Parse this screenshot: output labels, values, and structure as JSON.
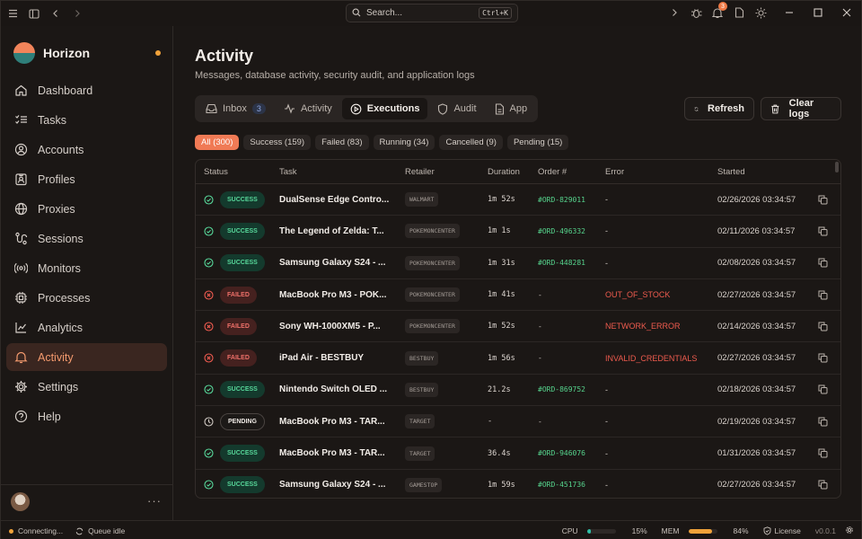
{
  "search": {
    "placeholder": "Search...",
    "shortcut": "Ctrl+K"
  },
  "topbar": {
    "notification_count": "3"
  },
  "brand": {
    "name": "Horizon"
  },
  "sidebar": {
    "items": [
      {
        "label": "Dashboard",
        "icon": "house-icon"
      },
      {
        "label": "Tasks",
        "icon": "list-checks-icon"
      },
      {
        "label": "Accounts",
        "icon": "user-circle-icon"
      },
      {
        "label": "Profiles",
        "icon": "id-card-icon"
      },
      {
        "label": "Proxies",
        "icon": "globe-icon"
      },
      {
        "label": "Sessions",
        "icon": "route-icon"
      },
      {
        "label": "Monitors",
        "icon": "radio-icon"
      },
      {
        "label": "Processes",
        "icon": "cpu-icon"
      },
      {
        "label": "Analytics",
        "icon": "chart-line-icon"
      },
      {
        "label": "Activity",
        "icon": "bell-icon",
        "active": true
      },
      {
        "label": "Settings",
        "icon": "gear-icon"
      },
      {
        "label": "Help",
        "icon": "help-circle-icon"
      }
    ]
  },
  "page": {
    "title": "Activity",
    "subtitle": "Messages, database activity, security audit, and application logs"
  },
  "tabs": [
    {
      "label": "Inbox",
      "count": "3"
    },
    {
      "label": "Activity"
    },
    {
      "label": "Executions",
      "active": true
    },
    {
      "label": "Audit"
    },
    {
      "label": "App"
    }
  ],
  "actions": {
    "refresh": "Refresh",
    "clear": "Clear logs"
  },
  "filters": [
    {
      "label": "All (300)",
      "active": true
    },
    {
      "label": "Success (159)"
    },
    {
      "label": "Failed (83)"
    },
    {
      "label": "Running (34)"
    },
    {
      "label": "Cancelled (9)"
    },
    {
      "label": "Pending (15)"
    }
  ],
  "table": {
    "headers": [
      "Status",
      "Task",
      "Retailer",
      "Duration",
      "Order #",
      "Error",
      "Started"
    ],
    "rows": [
      {
        "status": "SUCCESS",
        "kind": "success",
        "task": "DualSense Edge Contro...",
        "retailer": "WALMART",
        "duration": "1m 52s",
        "order": "#ORD-829011",
        "error": "-",
        "started": "02/26/2026 03:34:57"
      },
      {
        "status": "SUCCESS",
        "kind": "success",
        "task": "The Legend of Zelda: T...",
        "retailer": "POKEMONCENTER",
        "duration": "1m 1s",
        "order": "#ORD-496332",
        "error": "-",
        "started": "02/11/2026 03:34:57"
      },
      {
        "status": "SUCCESS",
        "kind": "success",
        "task": "Samsung Galaxy S24 - ...",
        "retailer": "POKEMONCENTER",
        "duration": "1m 31s",
        "order": "#ORD-448281",
        "error": "-",
        "started": "02/08/2026 03:34:57"
      },
      {
        "status": "FAILED",
        "kind": "failed",
        "task": "MacBook Pro M3 - POK...",
        "retailer": "POKEMONCENTER",
        "duration": "1m 41s",
        "order": "-",
        "error": "OUT_OF_STOCK",
        "started": "02/27/2026 03:34:57"
      },
      {
        "status": "FAILED",
        "kind": "failed",
        "task": "Sony WH-1000XM5 - P...",
        "retailer": "POKEMONCENTER",
        "duration": "1m 52s",
        "order": "-",
        "error": "NETWORK_ERROR",
        "started": "02/14/2026 03:34:57"
      },
      {
        "status": "FAILED",
        "kind": "failed",
        "task": "iPad Air - BESTBUY",
        "retailer": "BESTBUY",
        "duration": "1m 56s",
        "order": "-",
        "error": "INVALID_CREDENTIALS",
        "started": "02/27/2026 03:34:57"
      },
      {
        "status": "SUCCESS",
        "kind": "success",
        "task": "Nintendo Switch OLED ...",
        "retailer": "BESTBUY",
        "duration": "21.2s",
        "order": "#ORD-869752",
        "error": "-",
        "started": "02/18/2026 03:34:57"
      },
      {
        "status": "PENDING",
        "kind": "pending",
        "task": "MacBook Pro M3 - TAR...",
        "retailer": "TARGET",
        "duration": "-",
        "order": "-",
        "error": "-",
        "started": "02/19/2026 03:34:57"
      },
      {
        "status": "SUCCESS",
        "kind": "success",
        "task": "MacBook Pro M3 - TAR...",
        "retailer": "TARGET",
        "duration": "36.4s",
        "order": "#ORD-946076",
        "error": "-",
        "started": "01/31/2026 03:34:57"
      },
      {
        "status": "SUCCESS",
        "kind": "success",
        "task": "Samsung Galaxy S24 - ...",
        "retailer": "GAMESTOP",
        "duration": "1m 59s",
        "order": "#ORD-451736",
        "error": "-",
        "started": "02/27/2026 03:34:57"
      }
    ]
  },
  "statusbar": {
    "connection": "Connecting...",
    "queue": "Queue idle",
    "cpu_label": "CPU",
    "cpu_value": "15%",
    "cpu_fraction": 0.15,
    "mem_label": "MEM",
    "mem_value": "84%",
    "mem_fraction": 0.84,
    "license": "License",
    "version": "v0.0.1"
  },
  "colors": {
    "accent": "#f07a55",
    "success": "#57d79a",
    "failed": "#ef7069",
    "mem_bar": "#f0a23a",
    "cpu_bar": "#2fbfa7"
  }
}
